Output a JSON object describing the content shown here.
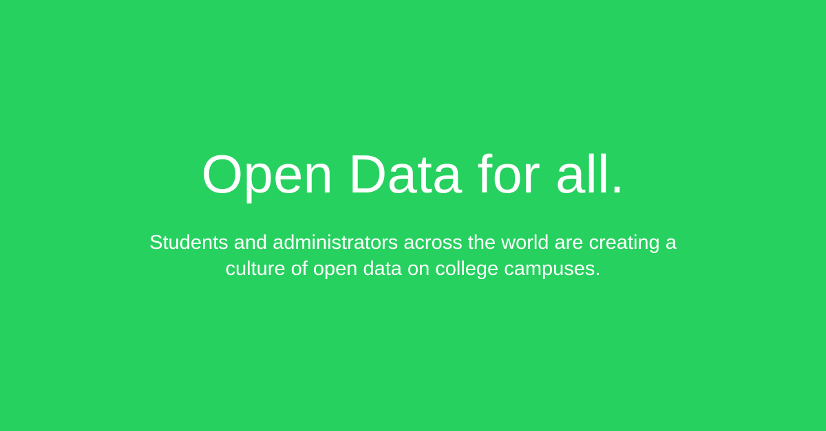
{
  "hero": {
    "title": "Open Data for all.",
    "subtitle_lines": [
      "Students and administrators across the world are creating a",
      "culture of open data on college campuses."
    ]
  },
  "colors": {
    "background": "#27D15F",
    "text": "#FFFFFF"
  }
}
